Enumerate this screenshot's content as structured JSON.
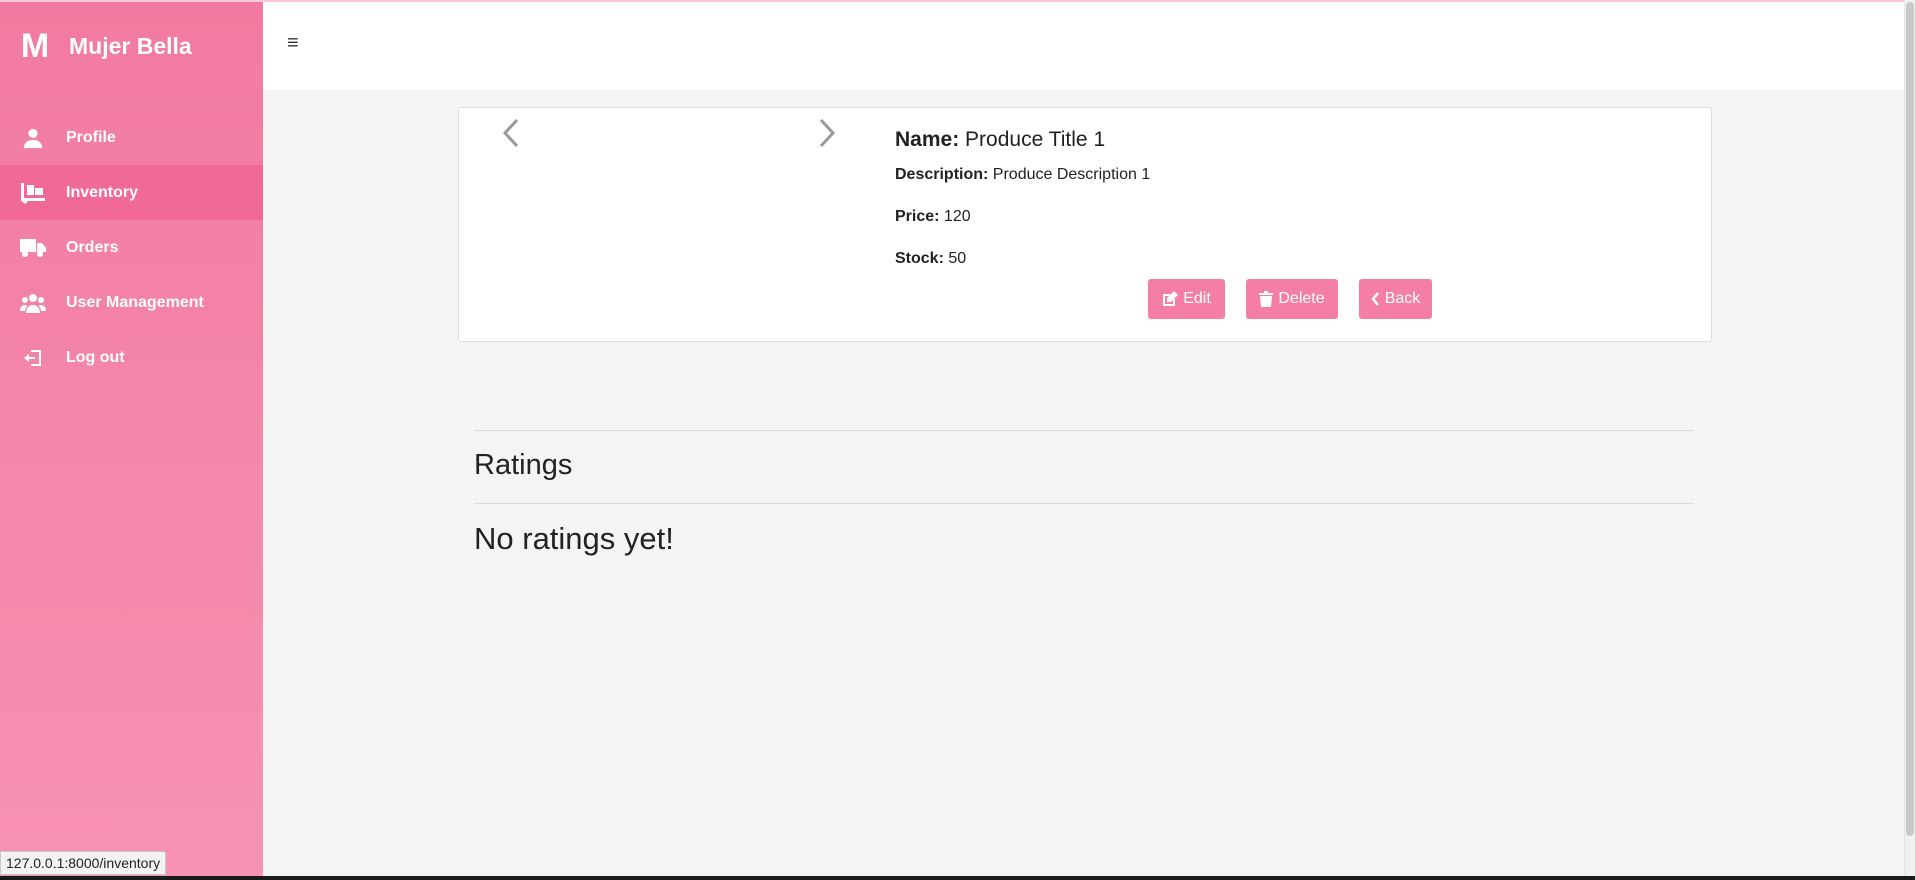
{
  "app": {
    "logo_letter": "M",
    "name": "Mujer Bella",
    "accent_color": "#f27aa0"
  },
  "sidebar": {
    "items": [
      {
        "label": "Profile",
        "icon": "user-icon",
        "active": false
      },
      {
        "label": "Inventory",
        "icon": "dolly-icon",
        "active": true
      },
      {
        "label": "Orders",
        "icon": "truck-icon",
        "active": false
      },
      {
        "label": "User Management",
        "icon": "users-icon",
        "active": false
      },
      {
        "label": "Log out",
        "icon": "logout-icon",
        "active": false
      }
    ]
  },
  "header": {
    "menu_icon": "≡"
  },
  "product": {
    "name_label": "Name:",
    "name_value": "Produce Title 1",
    "description_label": "Description:",
    "description_value": "Produce Description 1",
    "price_label": "Price:",
    "price_value": "120",
    "stock_label": "Stock:",
    "stock_value": "50"
  },
  "actions": {
    "edit_label": "Edit",
    "delete_label": "Delete",
    "back_label": "Back"
  },
  "ratings": {
    "heading": "Ratings",
    "empty_message": "No ratings yet!"
  },
  "status_bar": {
    "url": "127.0.0.1:8000/inventory"
  }
}
